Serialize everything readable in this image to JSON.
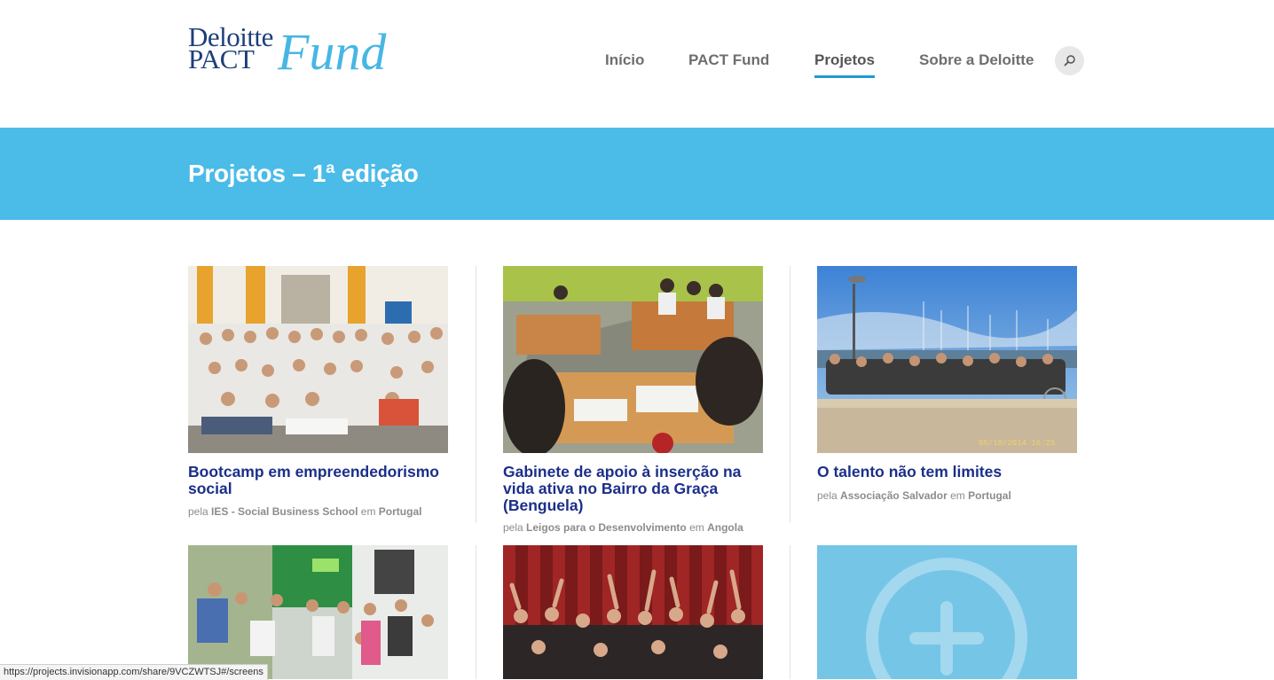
{
  "logo": {
    "line1": "Deloitte",
    "line2": "PACT",
    "line3": "Fund"
  },
  "nav": [
    {
      "label": "Início"
    },
    {
      "label": "PACT Fund"
    },
    {
      "label": "Projetos"
    },
    {
      "label": "Sobre a Deloitte"
    }
  ],
  "banner": {
    "title": "Projetos – 1ª edição"
  },
  "projects": [
    {
      "title": "Bootcamp em empreendedorismo social",
      "by": "pela",
      "org": "IES - Social Business School",
      "in": "em",
      "country": "Portugal"
    },
    {
      "title": "Gabinete de apoio à inserção na vida ativa no Bairro da Graça (Benguela)",
      "by": "pela",
      "org": "Leigos para o Desenvolvimento",
      "in": "em",
      "country": "Angola"
    },
    {
      "title": "O talento não tem limites",
      "by": "pela",
      "org": "Associação Salvador",
      "in": "em",
      "country": "Portugal",
      "photo_stamp": "05/10/2014 16:25"
    }
  ],
  "status_bar": "https://projects.invisionapp.com/share/9VCZWTSJ#/screens",
  "colors": {
    "accent": "#4bbbe8",
    "nav_underline": "#1e9ad6",
    "title_blue": "#1b2f8a"
  }
}
